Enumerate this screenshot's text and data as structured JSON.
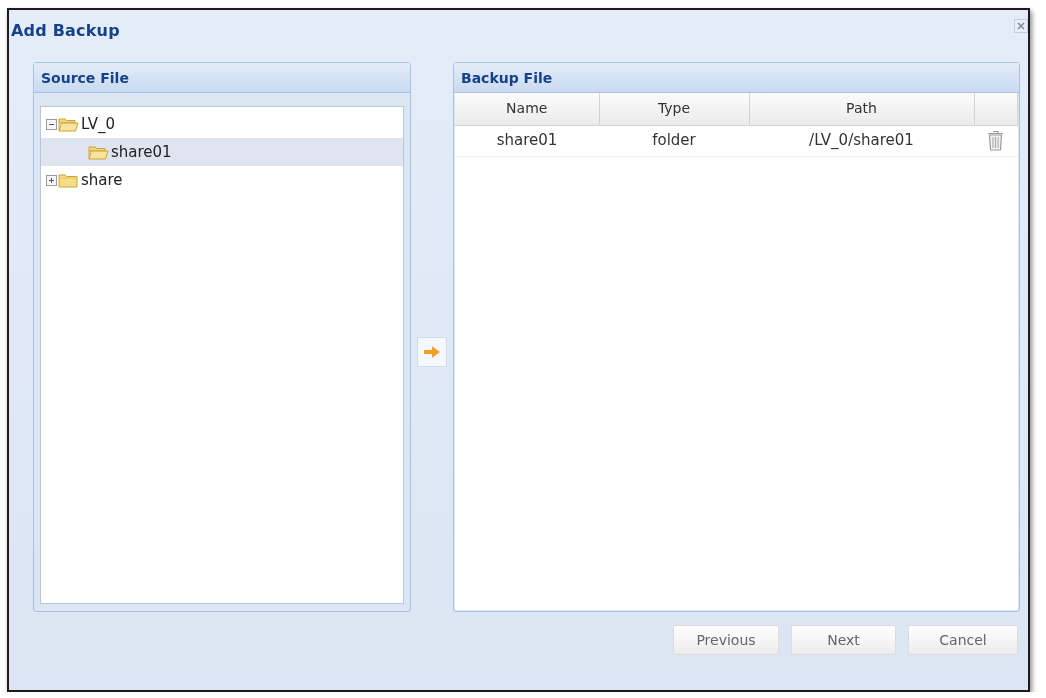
{
  "window": {
    "title": "Add Backup"
  },
  "source_panel": {
    "title": "Source File",
    "tree": [
      {
        "label": "LV_0",
        "expanded": true,
        "selected": false,
        "children": [
          {
            "label": "share01",
            "selected": true
          }
        ]
      },
      {
        "label": "share",
        "expanded": false,
        "selected": false
      }
    ]
  },
  "backup_panel": {
    "title": "Backup File",
    "table": {
      "columns": [
        "Name",
        "Type",
        "Path"
      ],
      "rows": [
        {
          "cells": [
            "share01",
            "folder",
            "/LV_0/share01"
          ]
        }
      ]
    }
  },
  "buttons": [
    "Previous",
    "Next",
    "Cancel"
  ]
}
